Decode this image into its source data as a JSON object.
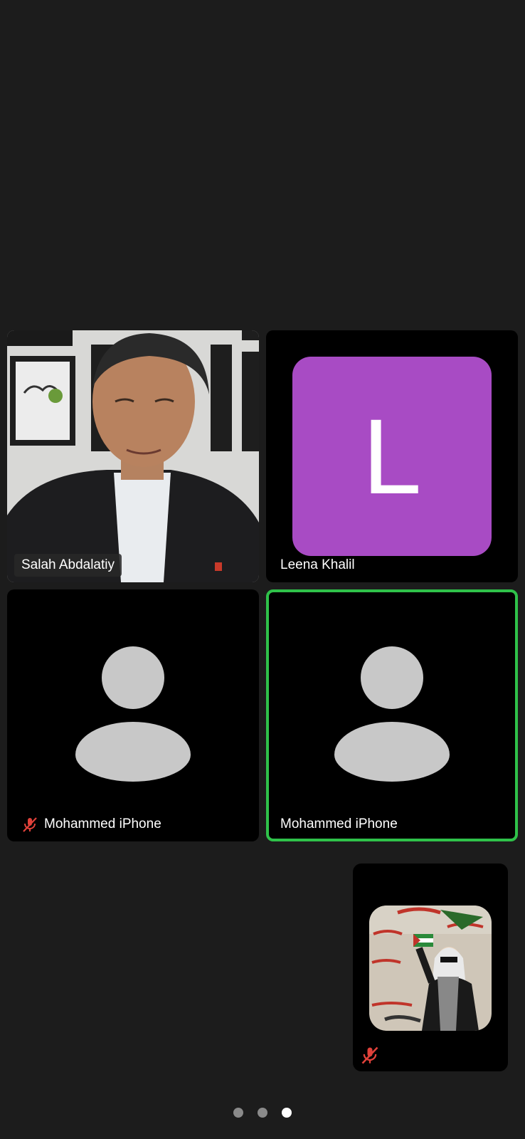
{
  "participants": [
    {
      "name": "Salah Abdalatiy",
      "muted": false,
      "video": true
    },
    {
      "name": "Leena Khalil",
      "muted": false,
      "video": false,
      "initial": "L",
      "avatar_color": "#a84bc4"
    },
    {
      "name": "Mohammed iPhone",
      "muted": true,
      "video": false
    },
    {
      "name": "Mohammed iPhone",
      "muted": false,
      "video": false,
      "active_speaker": true
    }
  ],
  "self_view": {
    "muted": true
  },
  "pagination": {
    "pages": 3,
    "current": 3
  },
  "colors": {
    "background": "#1c1c1c",
    "tile": "#000000",
    "speaker_border": "#2fc24a",
    "mute_red": "#e0413a",
    "avatar_gray": "#c8c8c8"
  }
}
